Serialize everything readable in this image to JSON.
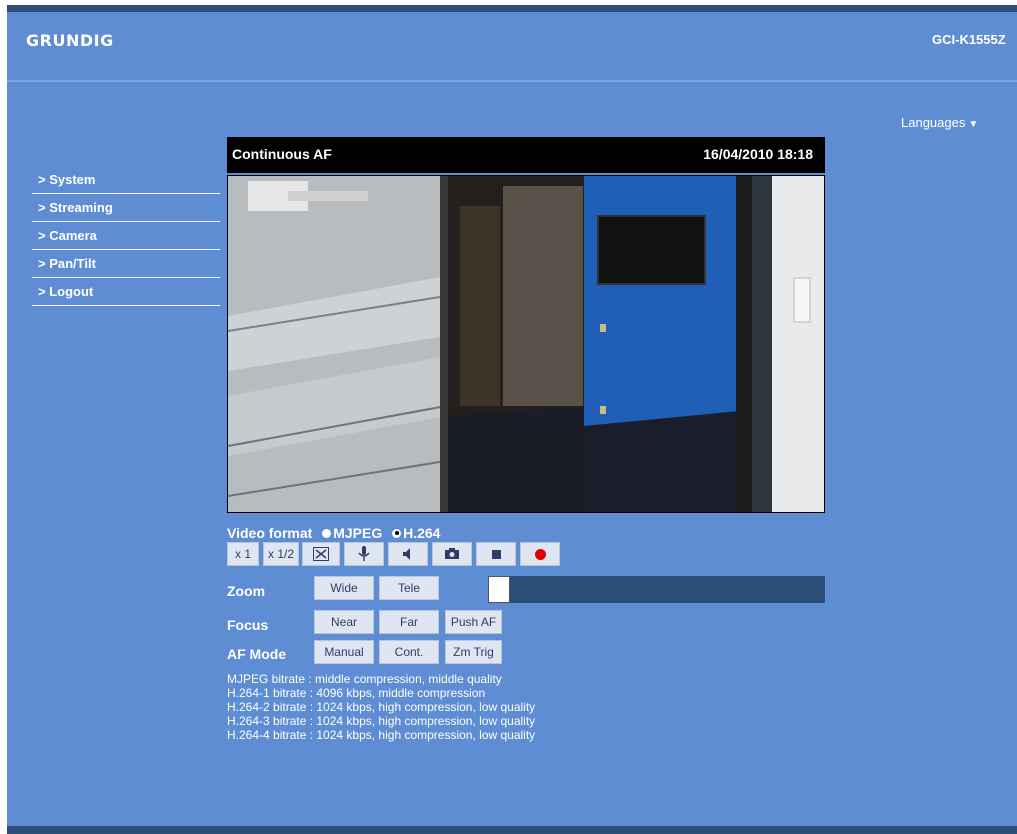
{
  "header": {
    "logo": "GRUNDIG",
    "model": "GCI-K1555Z"
  },
  "languages": {
    "label": "Languages",
    "arrow": "▼"
  },
  "sidebar": {
    "items": [
      {
        "label": "> System"
      },
      {
        "label": "> Streaming"
      },
      {
        "label": "> Camera"
      },
      {
        "label": "> Pan/Tilt"
      },
      {
        "label": "> Logout"
      }
    ]
  },
  "video": {
    "title": "Continuous AF",
    "datetime": "16/04/2010 18:18"
  },
  "video_format": {
    "label": "Video format",
    "options": [
      "MJPEG",
      "H.264"
    ],
    "selected": "H.264"
  },
  "toolbar": {
    "x1": "x 1",
    "x_half": "x 1/2",
    "icons": [
      "fullscreen-icon",
      "microphone-icon",
      "speaker-icon",
      "camera-icon",
      "stop-icon",
      "record-icon"
    ]
  },
  "zoom": {
    "label": "Zoom",
    "wide": "Wide",
    "tele": "Tele"
  },
  "focus": {
    "label": "Focus",
    "near": "Near",
    "far": "Far",
    "push_af": "Push AF"
  },
  "af_mode": {
    "label": "AF Mode",
    "manual": "Manual",
    "cont": "Cont.",
    "zm_trig": "Zm Trig"
  },
  "bitrates": [
    "MJPEG bitrate : middle compression, middle quality",
    "H.264-1 bitrate : 4096 kbps, middle compression",
    "H.264-2 bitrate : 1024 kbps, high compression, low quality",
    "H.264-3 bitrate : 1024 kbps, high compression, low quality",
    "H.264-4 bitrate : 1024 kbps, high compression, low quality"
  ],
  "colors": {
    "page_bg": "#5f8dd3",
    "dark": "#2c4e78",
    "record": "#e00000"
  }
}
